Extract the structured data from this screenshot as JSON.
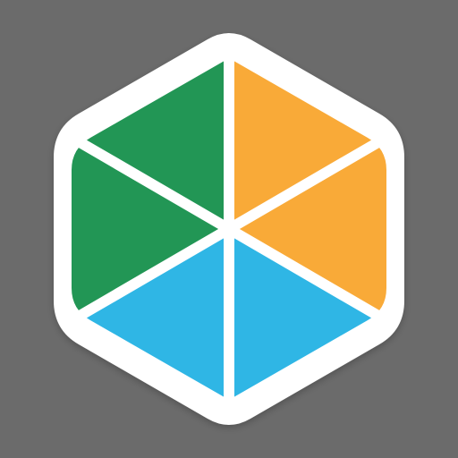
{
  "icon": {
    "name": "hexagon-segments-icon",
    "colors": {
      "background": "#6b6b6b",
      "frame": "#ffffff",
      "green": "#229655",
      "orange": "#f9aa38",
      "blue": "#2fb6e5"
    }
  }
}
